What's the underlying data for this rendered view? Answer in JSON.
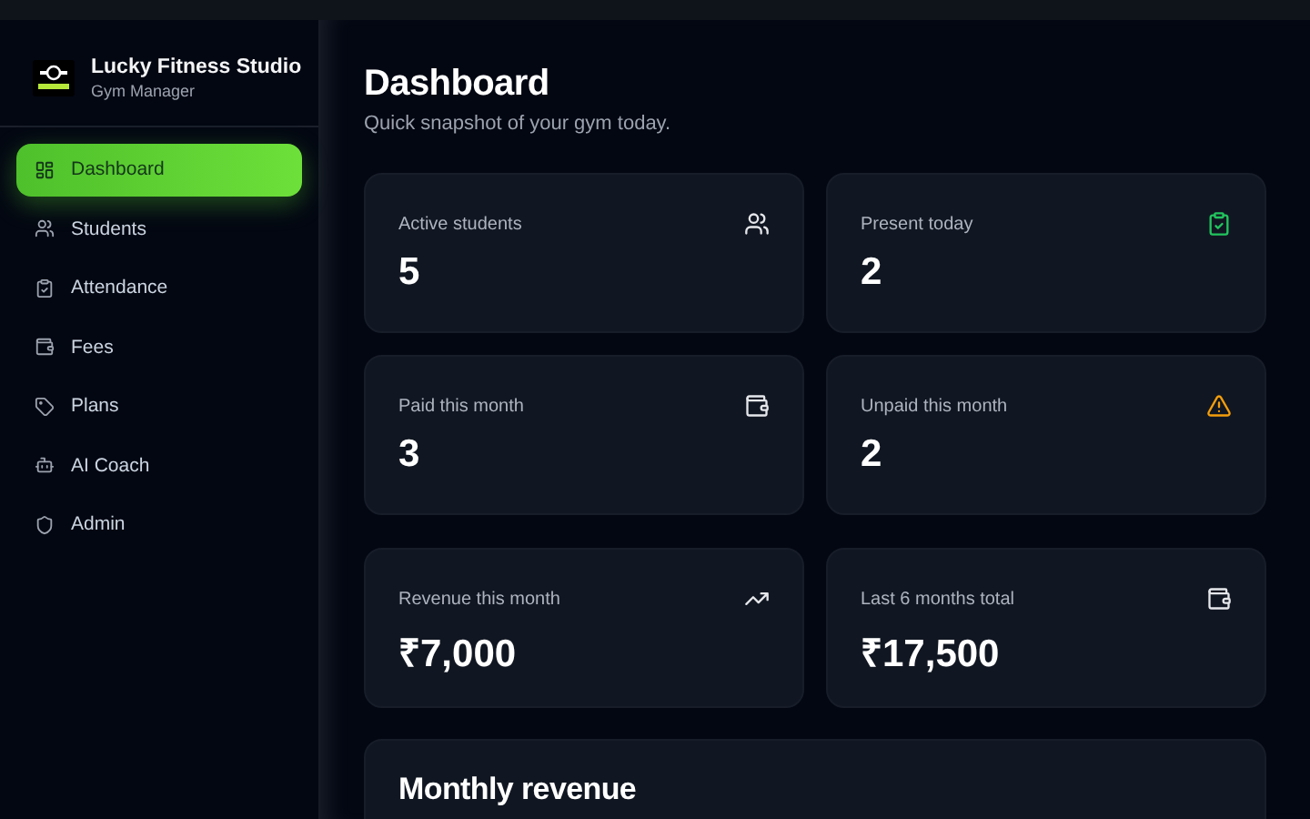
{
  "brand": {
    "title": "Lucky Fitness Studio",
    "subtitle": "Gym Manager"
  },
  "nav": [
    {
      "label": "Dashboard",
      "kind": "grid",
      "selected": true
    },
    {
      "label": "Students",
      "kind": "users",
      "selected": false
    },
    {
      "label": "Attendance",
      "kind": "clipboard",
      "selected": false
    },
    {
      "label": "Fees",
      "kind": "wallet",
      "selected": false
    },
    {
      "label": "Plans",
      "kind": "tag",
      "selected": false
    },
    {
      "label": "AI Coach",
      "kind": "bot",
      "selected": false
    },
    {
      "label": "Admin",
      "kind": "shield",
      "selected": false
    }
  ],
  "header": {
    "title": "Dashboard",
    "subtitle": "Quick snapshot of your gym today."
  },
  "stats": [
    {
      "label": "Active students",
      "value": "5",
      "kind": "users",
      "color": "#e5e7eb"
    },
    {
      "label": "Present today",
      "value": "2",
      "kind": "clipboard",
      "color": "#22c55e"
    },
    {
      "label": "Paid this month",
      "value": "3",
      "kind": "wallet",
      "color": "#e5e7eb"
    },
    {
      "label": "Unpaid this month",
      "value": "2",
      "kind": "warning",
      "color": "#f59e0b"
    },
    {
      "label": "Revenue this month",
      "value": "₹7,000",
      "kind": "trend",
      "color": "#e5e7eb"
    },
    {
      "label": "Last 6 months total",
      "value": "₹17,500",
      "kind": "wallet",
      "color": "#e5e7eb"
    }
  ],
  "revenue_panel": {
    "title": "Monthly revenue"
  }
}
